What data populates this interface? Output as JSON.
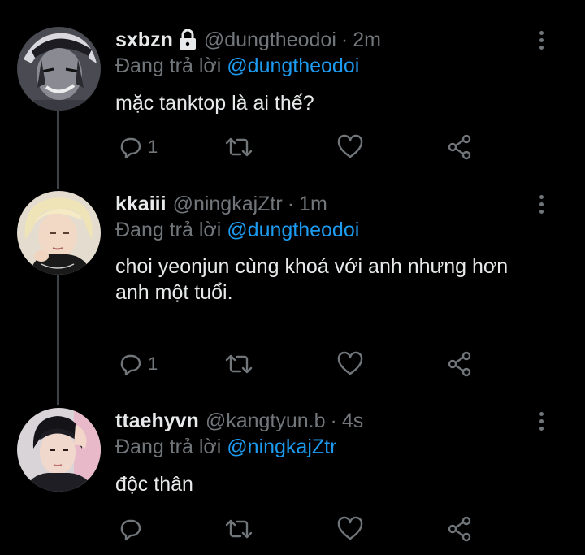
{
  "colors": {
    "background": "#000000",
    "name": "#e7e9ea",
    "secondary": "#71767b",
    "mention": "#1d9bf0",
    "thread_line": "#3d4248"
  },
  "tweets": [
    {
      "name": "sxbzn",
      "locked": true,
      "handle": "@dungtheodoi",
      "separator": "·",
      "time": "2m",
      "replying_prefix": "Đang trả lời ",
      "replying_to": "@dungtheodoi",
      "text_lines": [
        "mặc tanktop là ai thế?"
      ],
      "reply_count": "1",
      "avatar_icon": "anime-character-avatar"
    },
    {
      "name": "kkaiii",
      "locked": false,
      "handle": "@ningkajZtr",
      "separator": "·",
      "time": "1m",
      "replying_prefix": "Đang trả lời ",
      "replying_to": "@dungtheodoi",
      "text_lines": [
        "choi yeonjun cùng khoá với anh nhưng hơn",
        "anh một tuổi."
      ],
      "reply_count": "1",
      "avatar_icon": "blonde-person-avatar"
    },
    {
      "name": "ttaehyvn",
      "locked": false,
      "handle": "@kangtyun.b",
      "separator": "·",
      "time": "4s",
      "replying_prefix": "Đang trả lời ",
      "replying_to": "@ningkajZtr",
      "text_lines": [
        "độc thân"
      ],
      "reply_count": "",
      "avatar_icon": "dark-haired-person-avatar"
    }
  ],
  "icons": {
    "reply": "reply-icon",
    "retweet": "retweet-icon",
    "like": "heart-icon",
    "share": "share-icon",
    "more": "more-vertical-icon",
    "lock": "lock-icon"
  }
}
